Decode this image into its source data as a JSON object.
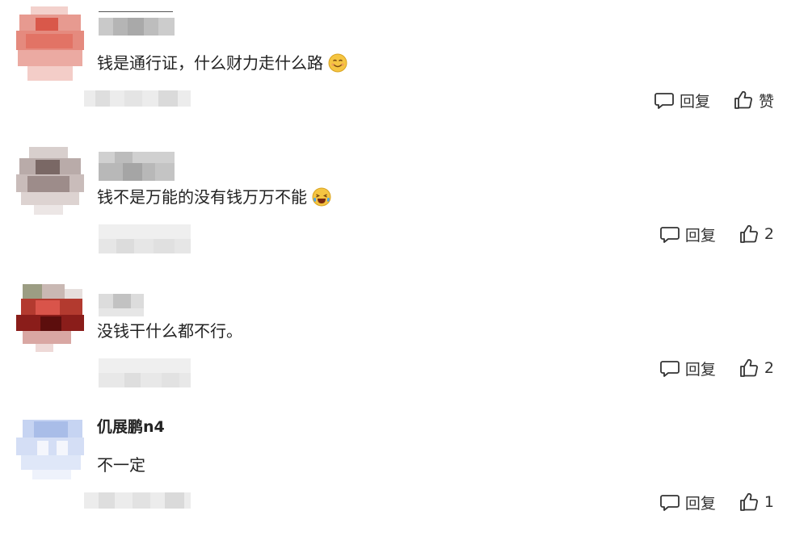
{
  "comments": [
    {
      "username": "",
      "text": "钱是通行证，什么财力走什么路",
      "emoji": "smiling-face-icon",
      "reply_label": "回复",
      "like_label": "赞",
      "avatar_colors": [
        "#e07a6e",
        "#e8968c",
        "#f0b3ab",
        "#d9584a"
      ]
    },
    {
      "username": "",
      "text": "钱不是万能的没有钱万万不能",
      "emoji": "laughing-tears-face-icon",
      "reply_label": "回复",
      "like_label": "2",
      "avatar_colors": [
        "#9d8c8a",
        "#b5a6a4",
        "#cfc4c2",
        "#7a6865"
      ]
    },
    {
      "username": "",
      "text": "没钱干什么都不行。",
      "emoji": "",
      "reply_label": "回复",
      "like_label": "2",
      "avatar_colors": [
        "#8a1d1a",
        "#b33a2f",
        "#d98c86",
        "#5c0e0d"
      ]
    },
    {
      "username": "仉展鹏n4",
      "text": "不一定",
      "emoji": "",
      "reply_label": "回复",
      "like_label": "1",
      "avatar_colors": [
        "#b9c9ec",
        "#d4def5",
        "#e6ecfa",
        "#9fb4e3"
      ]
    }
  ]
}
